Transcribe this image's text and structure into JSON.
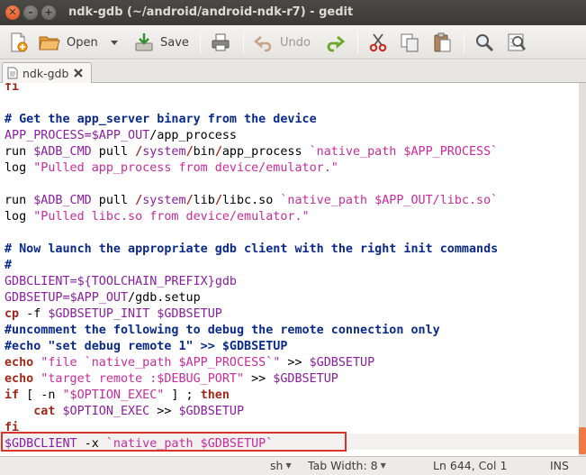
{
  "window": {
    "title": "ndk-gdb (~/android/android-ndk-r7) - gedit",
    "close_glyph": "✕",
    "minimize_glyph": "–",
    "maximize_glyph": "+"
  },
  "toolbar": {
    "open_label": "Open",
    "save_label": "Save",
    "undo_label": "Undo"
  },
  "tab": {
    "label": "ndk-gdb"
  },
  "editor": {
    "lines": [
      [
        {
          "t": "fi",
          "c": "c-kw"
        }
      ],
      [],
      [
        {
          "t": "# Get the app_server binary from the device",
          "c": "c-comment"
        }
      ],
      [
        {
          "t": "APP_PROCESS=",
          "c": "c-var"
        },
        {
          "t": "$APP_OUT",
          "c": "c-var"
        },
        {
          "t": "/",
          "c": ""
        },
        {
          "t": "app_process",
          "c": ""
        }
      ],
      [
        {
          "t": "run ",
          "c": ""
        },
        {
          "t": "$ADB_CMD",
          "c": "c-var"
        },
        {
          "t": " pull ",
          "c": ""
        },
        {
          "t": "/",
          "c": "c-kw"
        },
        {
          "t": "system",
          "c": "c-var"
        },
        {
          "t": "/",
          "c": "c-kw"
        },
        {
          "t": "bin",
          "c": ""
        },
        {
          "t": "/",
          "c": "c-kw"
        },
        {
          "t": "app_process ",
          "c": ""
        },
        {
          "t": "`native_path $APP_PROCESS`",
          "c": "c-str"
        }
      ],
      [
        {
          "t": "log ",
          "c": ""
        },
        {
          "t": "\"Pulled app_process from device/emulator.\"",
          "c": "c-str"
        }
      ],
      [],
      [
        {
          "t": "run ",
          "c": ""
        },
        {
          "t": "$ADB_CMD",
          "c": "c-var"
        },
        {
          "t": " pull ",
          "c": ""
        },
        {
          "t": "/",
          "c": "c-kw"
        },
        {
          "t": "system",
          "c": "c-var"
        },
        {
          "t": "/",
          "c": "c-kw"
        },
        {
          "t": "lib",
          "c": ""
        },
        {
          "t": "/",
          "c": "c-kw"
        },
        {
          "t": "libc.so ",
          "c": ""
        },
        {
          "t": "`native_path $APP_OUT/libc.so`",
          "c": "c-str"
        }
      ],
      [
        {
          "t": "log ",
          "c": ""
        },
        {
          "t": "\"Pulled libc.so from device/emulator.\"",
          "c": "c-str"
        }
      ],
      [],
      [
        {
          "t": "# Now launch the appropriate gdb client with the right init commands",
          "c": "c-comment"
        }
      ],
      [
        {
          "t": "#",
          "c": "c-comment"
        }
      ],
      [
        {
          "t": "GDBCLIENT=",
          "c": "c-var"
        },
        {
          "t": "${TOOLCHAIN_PREFIX}",
          "c": "c-var"
        },
        {
          "t": "gdb",
          "c": "c-var"
        }
      ],
      [
        {
          "t": "GDBSETUP=",
          "c": "c-var"
        },
        {
          "t": "$APP_OUT",
          "c": "c-var"
        },
        {
          "t": "/",
          "c": ""
        },
        {
          "t": "gdb.setup",
          "c": ""
        }
      ],
      [
        {
          "t": "cp",
          "c": "c-kw"
        },
        {
          "t": " -f ",
          "c": ""
        },
        {
          "t": "$GDBSETUP_INIT $GDBSETUP",
          "c": "c-var"
        }
      ],
      [
        {
          "t": "#uncomment the following to debug the remote connection only",
          "c": "c-comment"
        }
      ],
      [
        {
          "t": "#echo \"set debug remote 1\" >> $GDBSETUP",
          "c": "c-comment"
        }
      ],
      [
        {
          "t": "echo",
          "c": "c-kw"
        },
        {
          "t": " \"file `native_path $APP_PROCESS`\"",
          "c": "c-str"
        },
        {
          "t": " >> ",
          "c": ""
        },
        {
          "t": "$GDBSETUP",
          "c": "c-var"
        }
      ],
      [
        {
          "t": "echo",
          "c": "c-kw"
        },
        {
          "t": " \"target remote :$DEBUG_PORT\"",
          "c": "c-str"
        },
        {
          "t": " >> ",
          "c": ""
        },
        {
          "t": "$GDBSETUP",
          "c": "c-var"
        }
      ],
      [
        {
          "t": "if",
          "c": "c-kw"
        },
        {
          "t": " [ -n ",
          "c": ""
        },
        {
          "t": "\"$OPTION_EXEC\"",
          "c": "c-str"
        },
        {
          "t": " ] ; ",
          "c": ""
        },
        {
          "t": "then",
          "c": "c-kw"
        }
      ],
      [
        {
          "t": "    ",
          "c": ""
        },
        {
          "t": "cat",
          "c": "c-kw"
        },
        {
          "t": " ",
          "c": ""
        },
        {
          "t": "$OPTION_EXEC",
          "c": "c-var"
        },
        {
          "t": " >> ",
          "c": ""
        },
        {
          "t": "$GDBSETUP",
          "c": "c-var"
        }
      ],
      [
        {
          "t": "fi",
          "c": "c-kw"
        }
      ],
      [
        {
          "t": "$GDBCLIENT",
          "c": "c-var"
        },
        {
          "t": " -x ",
          "c": ""
        },
        {
          "t": "`native_path $GDBSETUP`",
          "c": "c-str"
        }
      ]
    ]
  },
  "statusbar": {
    "language": "sh",
    "tab_width": "Tab Width: 8",
    "position": "Ln 644, Col 1",
    "mode": "INS"
  },
  "colors": {
    "title_bg": "#3b3a36",
    "highlight_box": "#d8342a",
    "scroll_thumb": "#f07746"
  }
}
